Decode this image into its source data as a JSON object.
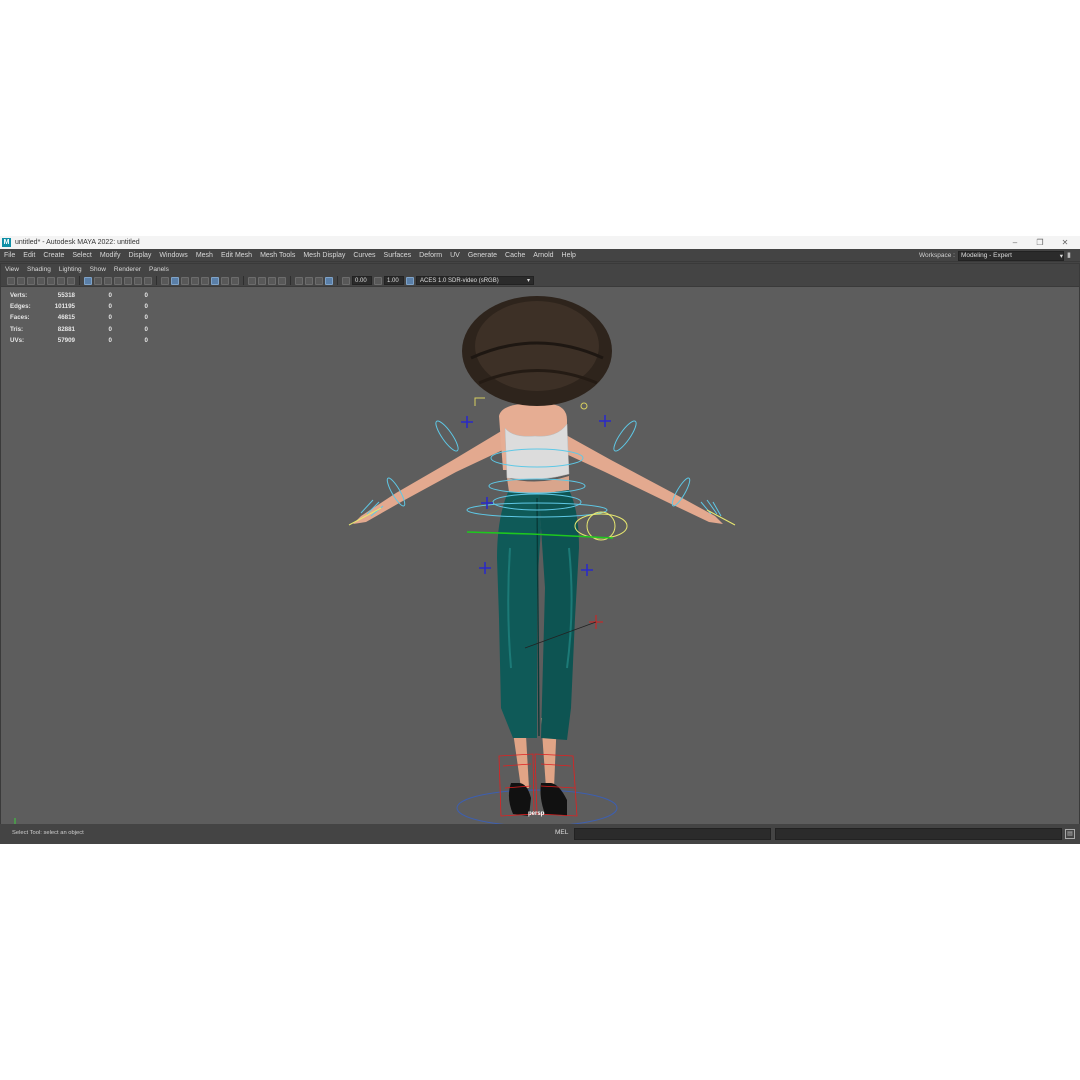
{
  "window": {
    "title": "untitled* - Autodesk MAYA 2022: untitled",
    "logo": "M"
  },
  "menubar": {
    "items": [
      "File",
      "Edit",
      "Create",
      "Select",
      "Modify",
      "Display",
      "Windows",
      "Mesh",
      "Edit Mesh",
      "Mesh Tools",
      "Mesh Display",
      "Curves",
      "Surfaces",
      "Deform",
      "UV",
      "Generate",
      "Cache",
      "Arnold",
      "Help"
    ],
    "workspace_label": "Workspace :",
    "workspace_value": "Modeling - Expert"
  },
  "panel": {
    "menu": [
      "View",
      "Shading",
      "Lighting",
      "Show",
      "Renderer",
      "Panels"
    ],
    "exposure": "0.00",
    "gamma": "1.00",
    "color_space": "ACES 1.0 SDR-video (sRGB)"
  },
  "hud": {
    "rows": [
      {
        "label": "Verts:",
        "a": "55318",
        "b": "0",
        "c": "0"
      },
      {
        "label": "Edges:",
        "a": "101195",
        "b": "0",
        "c": "0"
      },
      {
        "label": "Faces:",
        "a": "46815",
        "b": "0",
        "c": "0"
      },
      {
        "label": "Tris:",
        "a": "82881",
        "b": "0",
        "c": "0"
      },
      {
        "label": "UVs:",
        "a": "57909",
        "b": "0",
        "c": "0"
      }
    ]
  },
  "viewport": {
    "camera": "persp",
    "background_color": "#5d5d5d",
    "control_color": "#5ec8e6",
    "pants_color": "#0f5a58"
  },
  "statusbar": {
    "help_line": "Select Tool: select an object",
    "command_type": "MEL"
  }
}
